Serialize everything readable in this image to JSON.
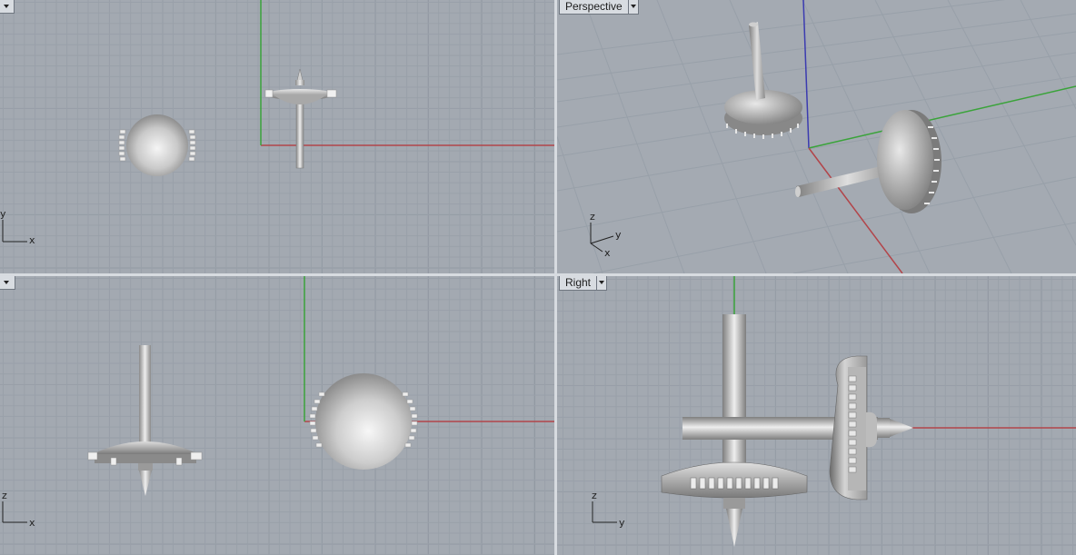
{
  "viewports": {
    "top": {
      "label": ""
    },
    "perspective": {
      "label": "Perspective"
    },
    "front": {
      "label": ""
    },
    "right": {
      "label": "Right"
    }
  },
  "axis_labels": {
    "top": {
      "horizontal": "x",
      "vertical": "y"
    },
    "perspective": {
      "vertical": "z",
      "depth_a": "y",
      "depth_b": "x"
    },
    "front": {
      "horizontal": "x",
      "vertical": "z"
    },
    "right": {
      "horizontal": "y",
      "vertical": "z"
    }
  },
  "colors": {
    "x_axis": "#b2454a",
    "y_axis": "#3aa33a",
    "z_axis": "#3b3bb0",
    "grid_minor": "#99a0a9",
    "grid_major": "#8e959f",
    "viewport_bg": "#a3a9b1"
  }
}
